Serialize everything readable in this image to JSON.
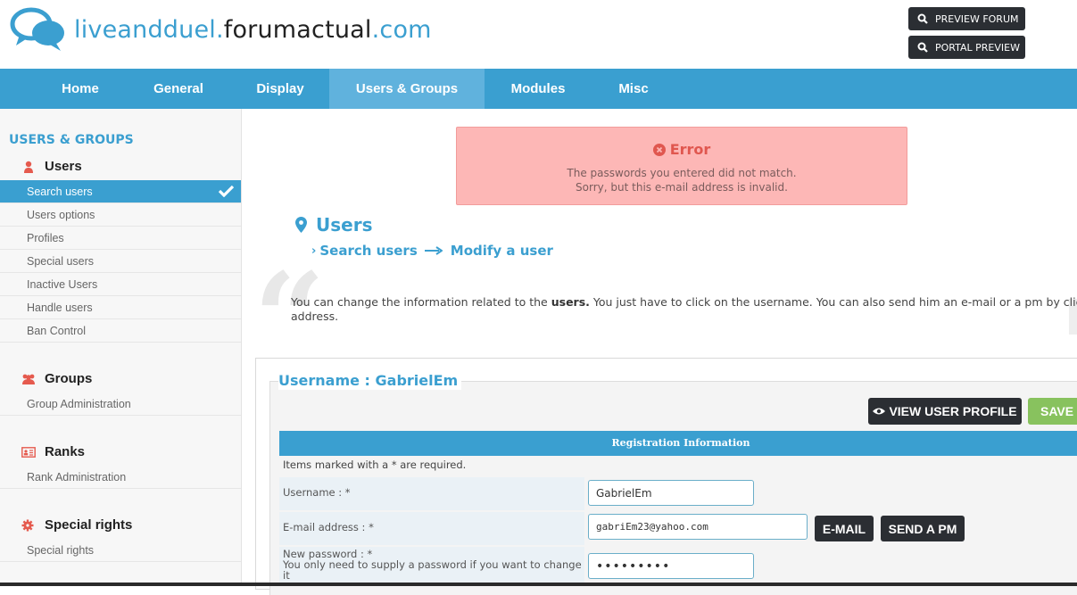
{
  "header": {
    "logo_part1": "liveandduel.",
    "logo_part2": "forumactual",
    "logo_part3": ".com",
    "preview_forum": "PREVIEW FORUM",
    "portal_preview": "PORTAL PREVIEW"
  },
  "nav": {
    "items": [
      {
        "label": "Home"
      },
      {
        "label": "General"
      },
      {
        "label": "Display"
      },
      {
        "label": "Users & Groups",
        "active": true
      },
      {
        "label": "Modules"
      },
      {
        "label": "Misc"
      }
    ]
  },
  "sidebar": {
    "title": "USERS & GROUPS",
    "sections": [
      {
        "heading": "Users",
        "icon": "user-icon",
        "links": [
          "Search users",
          "Users options",
          "Profiles",
          "Special users",
          "Inactive Users",
          "Handle users",
          "Ban Control"
        ],
        "active": "Search users"
      },
      {
        "heading": "Groups",
        "icon": "users-icon",
        "links": [
          "Group Administration"
        ]
      },
      {
        "heading": "Ranks",
        "icon": "id-card-icon",
        "links": [
          "Rank Administration"
        ]
      },
      {
        "heading": "Special rights",
        "icon": "gear-icon",
        "links": [
          "Special rights"
        ]
      }
    ]
  },
  "error": {
    "title": "Error",
    "messages": [
      "The passwords you entered did not match.",
      "Sorry, but this e-mail address is invalid."
    ]
  },
  "page": {
    "title": "Users",
    "breadcrumb": [
      "Search users",
      "Modify a user"
    ],
    "description_pre": "You can change the information related to the ",
    "description_bold": "users.",
    "description_post": " You just have to click on the username. You can also send him an e-mail or a pm by clicking on h",
    "description_line2": "address."
  },
  "form": {
    "legend": "Username : GabrielEm",
    "view_profile": "VIEW USER PROFILE",
    "save": "SAVE",
    "section_header": "Registration Information",
    "required_note": "Items marked with a * are required.",
    "fields": {
      "username_label": "Username : *",
      "username_value": "GabrielEm",
      "email_label": "E-mail address : *",
      "email_value": "gabriEm23@yahoo.com",
      "email_button": "E-MAIL",
      "pm_button": "SEND A PM",
      "password_label": "New password : *",
      "password_hint": "You only need to supply a password if you want to change it",
      "password_value": "•••••••••"
    }
  },
  "colors": {
    "accent": "#3a9fd0",
    "nav_active": "#60b2dd",
    "error_bg": "#fdb7b6",
    "error_text": "#e0574f",
    "save_green": "#88c25e",
    "dark_button": "#2b2e33",
    "sidebar_icon": "#e55a4e"
  }
}
